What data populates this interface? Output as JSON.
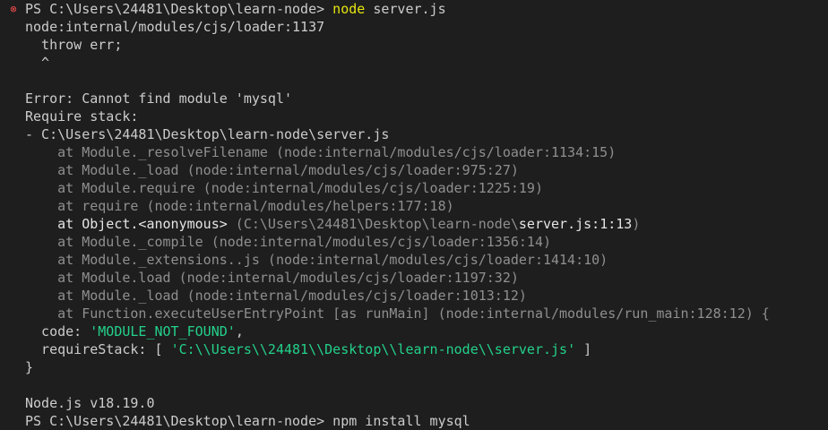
{
  "terminal": {
    "prompt": {
      "ps": "PS C:\\Users\\24481\\Desktop\\learn-node> ",
      "command": "node",
      "args": " server.js"
    },
    "loader_line": "node:internal/modules/cjs/loader:1137",
    "throw_line": "  throw err;",
    "caret_line": "  ^",
    "error_line": "Error: Cannot find module 'mysql'",
    "require_stack_line": "Require stack:",
    "stack_entry": "- C:\\Users\\24481\\Desktop\\learn-node\\server.js",
    "stack": [
      "    at Module._resolveFilename (node:internal/modules/cjs/loader:1134:15)",
      "    at Module._load (node:internal/modules/cjs/loader:975:27)",
      "    at Module.require (node:internal/modules/cjs/loader:1225:19)",
      "    at require (node:internal/modules/helpers:177:18)",
      "    at Module._compile (node:internal/modules/cjs/loader:1356:14)",
      "    at Module._extensions..js (node:internal/modules/cjs/loader:1414:10)",
      "    at Module.load (node:internal/modules/cjs/loader:1197:32)",
      "    at Module._load (node:internal/modules/cjs/loader:1013:12)",
      "    at Function.executeUserEntryPoint [as runMain] (node:internal/modules/run_main:128:12) {"
    ],
    "anon_frame": {
      "prefix": "    at Object.<anonymous>",
      "path": " (C:\\Users\\24481\\Desktop\\learn-node\\",
      "file": "server.js:1:13",
      "close": ")"
    },
    "code_line": {
      "key": "  code: ",
      "value": "'MODULE_NOT_FOUND'",
      "suffix": ","
    },
    "require_stack_prop": {
      "key": "  requireStack: [ ",
      "value": "'C:\\\\Users\\\\24481\\\\Desktop\\\\learn-node\\\\server.js'",
      "suffix": " ]"
    },
    "close_brace": "}",
    "node_version": "Node.js v18.19.0",
    "next_prompt_partial": "PS C:\\Users\\24481\\Desktop\\learn-node> npm install mysql"
  }
}
